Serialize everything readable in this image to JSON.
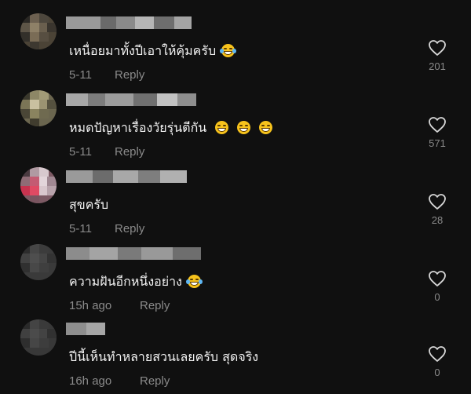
{
  "comments": [
    {
      "text": "เหนื่อยมาทั้งปีเอาให้คุ้มครับ",
      "emoji": "face-with-tears-of-joy",
      "date": "5-11",
      "reply_label": "Reply",
      "likes": "201",
      "username_blurred": true
    },
    {
      "text": "หมดปัญหาเรื่องวัยรุ่นตีกัน",
      "emoji": [
        "grinning-face-with-smiling-eyes",
        "grinning-face-with-smiling-eyes",
        "grinning-face-with-smiling-eyes"
      ],
      "date": "5-11",
      "reply_label": "Reply",
      "likes": "571",
      "username_blurred": true
    },
    {
      "text": "สุขครับ",
      "date": "5-11",
      "reply_label": "Reply",
      "likes": "28",
      "username_blurred": true
    },
    {
      "text": "ความฝันอีกหนึ่งอย่าง",
      "emoji": "face-with-tears-of-joy",
      "date": "15h ago",
      "reply_label": "Reply",
      "likes": "0",
      "username_blurred": true
    },
    {
      "text": "ปีนี้เห็นทำหลายสวนเลยครับ สุดจริง",
      "date": "16h ago",
      "reply_label": "Reply",
      "likes": "0",
      "username_blurred": true
    }
  ],
  "colors": {
    "background": "#101010",
    "text": "#f2f2f2",
    "meta": "#8a8a8a",
    "emoji": "#f6c21c"
  },
  "icons": {
    "like": "heart-outline-icon"
  }
}
